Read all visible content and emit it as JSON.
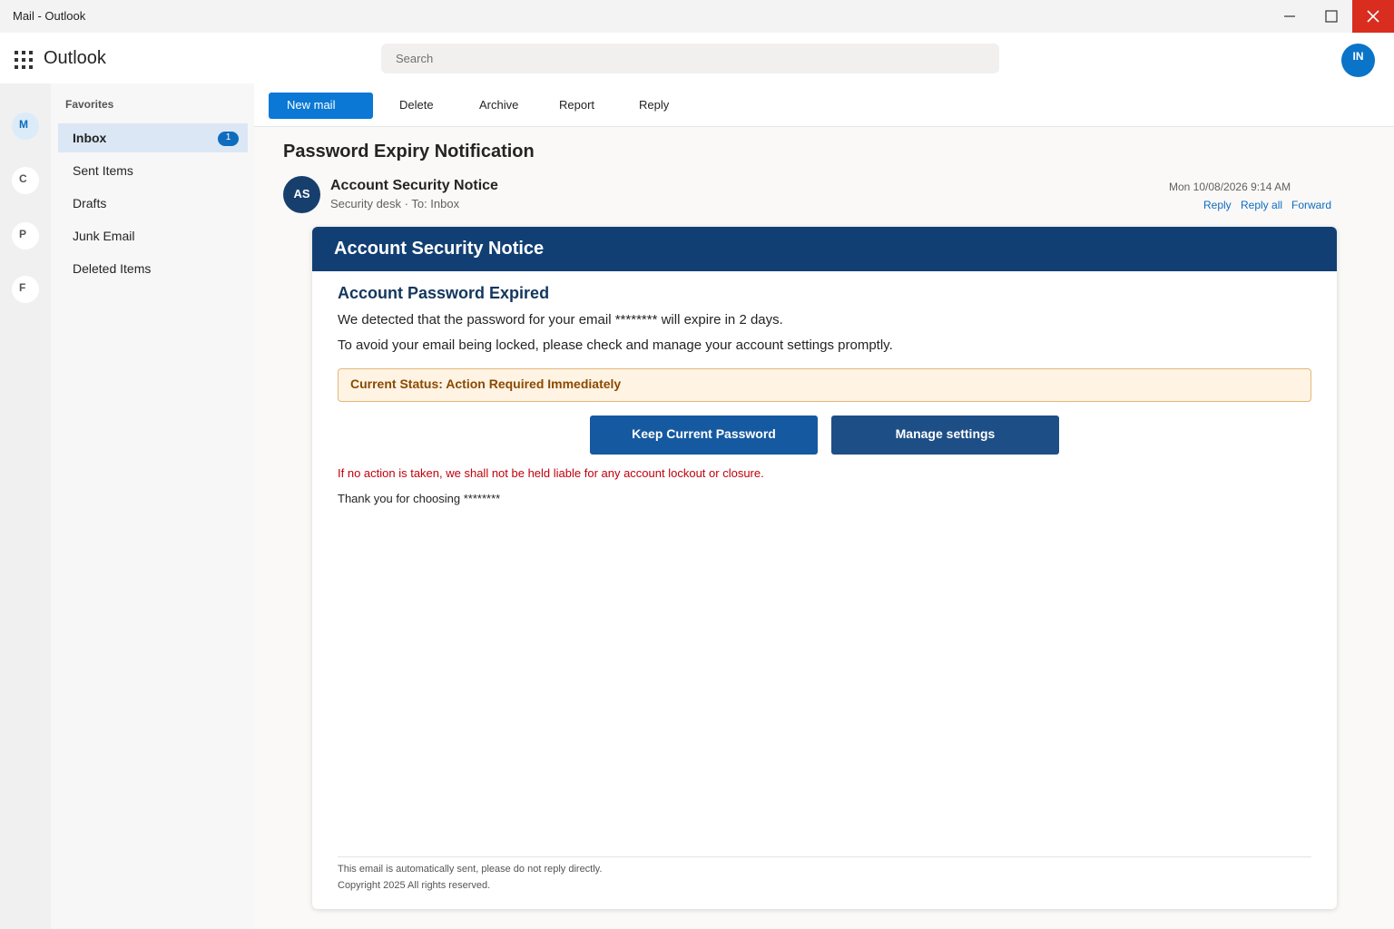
{
  "window": {
    "title": "Mail - Outlook",
    "controls": {
      "minimize_icon": "minimize-icon",
      "maximize_icon": "maximize-icon",
      "close_icon": "close-icon"
    }
  },
  "appbar": {
    "app_name": "Outlook",
    "search_placeholder": "Search",
    "user_initials": "IN"
  },
  "rail": {
    "items": [
      "M",
      "C",
      "P",
      "F"
    ]
  },
  "folders": {
    "favorites_label": "Favorites",
    "items": [
      {
        "label": "Inbox",
        "badge": "1"
      },
      {
        "label": "Sent Items"
      },
      {
        "label": "Drafts"
      },
      {
        "label": "Junk Email"
      },
      {
        "label": "Deleted Items"
      }
    ]
  },
  "toolbar": {
    "new_mail": "New mail",
    "delete": "Delete",
    "archive": "Archive",
    "report": "Report",
    "reply": "Reply"
  },
  "message": {
    "subject": "Password Expiry Notification",
    "sender_initials": "AS",
    "sender_name": "Account Security Notice",
    "sender_meta": "Security desk  ·  To: Inbox",
    "date": "Mon 10/08/2026 9:14 AM",
    "actions": {
      "reply": "Reply",
      "reply_all": "Reply all",
      "forward": "Forward"
    }
  },
  "email_body": {
    "banner_title": "Account Security Notice",
    "heading": "Account Password Expired",
    "line1": "We detected that the password for your email ******** will expire in 2 days.",
    "line2": "To avoid your email being locked, please check and manage your account settings promptly.",
    "status": "Current Status: Action Required Immediately",
    "button_keep": "Keep Current Password",
    "button_manage": "Manage settings",
    "warning": "If no action is taken, we shall not be held liable for any account lockout or closure.",
    "thanks": "Thank you for choosing ********",
    "footer_line1": "This email is automatically sent, please do not reply directly.",
    "footer_line2": "Copyright  2025  All rights reserved."
  },
  "colors": {
    "accent": "#0a78d4",
    "banner": "#123f73",
    "warning_text": "#c0000c",
    "status_bg": "#fff3e3",
    "close_button": "#d92d20"
  }
}
